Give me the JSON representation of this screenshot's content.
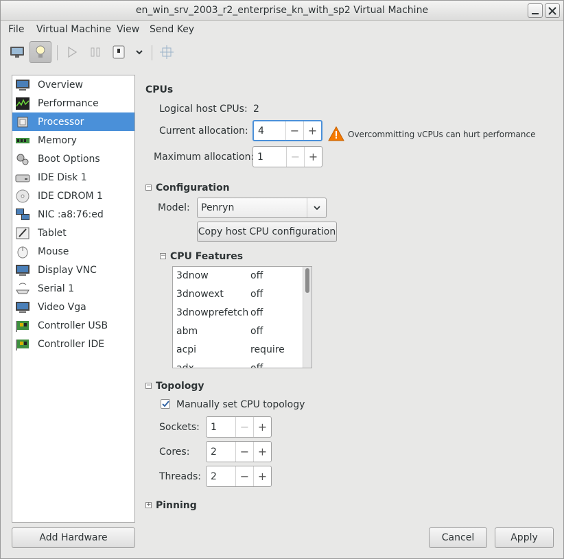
{
  "window": {
    "title": "en_win_srv_2003_r2_enterprise_kn_with_sp2 Virtual Machine"
  },
  "menubar": {
    "items": [
      "File",
      "Virtual Machine",
      "View",
      "Send Key"
    ]
  },
  "sidebar": {
    "items": [
      {
        "label": "Overview",
        "icon": "monitor-icon"
      },
      {
        "label": "Performance",
        "icon": "performance-graph-icon"
      },
      {
        "label": "Processor",
        "icon": "cpu-chip-icon",
        "selected": true
      },
      {
        "label": "Memory",
        "icon": "memory-module-icon"
      },
      {
        "label": "Boot Options",
        "icon": "gears-icon"
      },
      {
        "label": "IDE Disk 1",
        "icon": "hard-disk-icon"
      },
      {
        "label": "IDE CDROM 1",
        "icon": "cdrom-icon"
      },
      {
        "label": "NIC :a8:76:ed",
        "icon": "network-icon"
      },
      {
        "label": "Tablet",
        "icon": "tablet-icon"
      },
      {
        "label": "Mouse",
        "icon": "mouse-icon"
      },
      {
        "label": "Display VNC",
        "icon": "display-icon"
      },
      {
        "label": "Serial 1",
        "icon": "serial-port-icon"
      },
      {
        "label": "Video Vga",
        "icon": "video-icon"
      },
      {
        "label": "Controller USB",
        "icon": "controller-card-icon"
      },
      {
        "label": "Controller IDE",
        "icon": "controller-card-icon"
      }
    ],
    "add_hardware_label": "Add Hardware"
  },
  "cpus": {
    "heading": "CPUs",
    "logical_label": "Logical host CPUs:",
    "logical_value": "2",
    "current_label": "Current allocation:",
    "current_value": "4",
    "warning": "Overcommitting vCPUs can hurt performance",
    "max_label": "Maximum allocation:",
    "max_value": "1"
  },
  "configuration": {
    "heading": "Configuration",
    "model_label": "Model:",
    "model_value": "Penryn",
    "copy_button": "Copy host CPU configuration",
    "features_heading": "CPU Features",
    "features": [
      {
        "name": "3dnow",
        "value": "off"
      },
      {
        "name": "3dnowext",
        "value": "off"
      },
      {
        "name": "3dnowprefetch",
        "value": "off"
      },
      {
        "name": "abm",
        "value": "off"
      },
      {
        "name": "acpi",
        "value": "require"
      },
      {
        "name": "adx",
        "value": "off"
      }
    ]
  },
  "topology": {
    "heading": "Topology",
    "manual_label": "Manually set CPU topology",
    "manual_checked": true,
    "sockets_label": "Sockets:",
    "sockets_value": "1",
    "cores_label": "Cores:",
    "cores_value": "2",
    "threads_label": "Threads:",
    "threads_value": "2"
  },
  "pinning": {
    "heading": "Pinning"
  },
  "footer": {
    "cancel_label": "Cancel",
    "apply_label": "Apply"
  },
  "colors": {
    "selection": "#4a90d9",
    "warning": "#f57900"
  }
}
